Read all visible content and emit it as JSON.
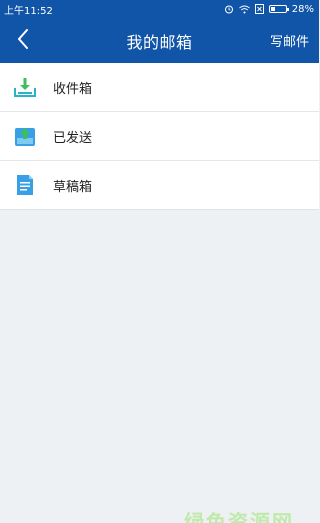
{
  "status_bar": {
    "time": "上午11:52",
    "battery": "28%",
    "battery_level": 0.28,
    "icons": [
      "alarm-icon",
      "wifi-icon",
      "sim-icon",
      "battery-icon"
    ]
  },
  "nav": {
    "title": "我的邮箱",
    "action_label": "写邮件",
    "back_icon": "chevron-left-icon"
  },
  "mailbox": {
    "items": [
      {
        "label": "收件箱",
        "icon": "inbox-download-icon"
      },
      {
        "label": "已发送",
        "icon": "sent-upload-icon"
      },
      {
        "label": "草稿箱",
        "icon": "draft-document-icon"
      }
    ]
  },
  "colors": {
    "header": "#1155a8",
    "icon_teal": "#29b3c9",
    "icon_green": "#3fbf5a",
    "icon_blue": "#3aa0e6",
    "background": "#eef1f4"
  },
  "watermark": "绿色资源网"
}
